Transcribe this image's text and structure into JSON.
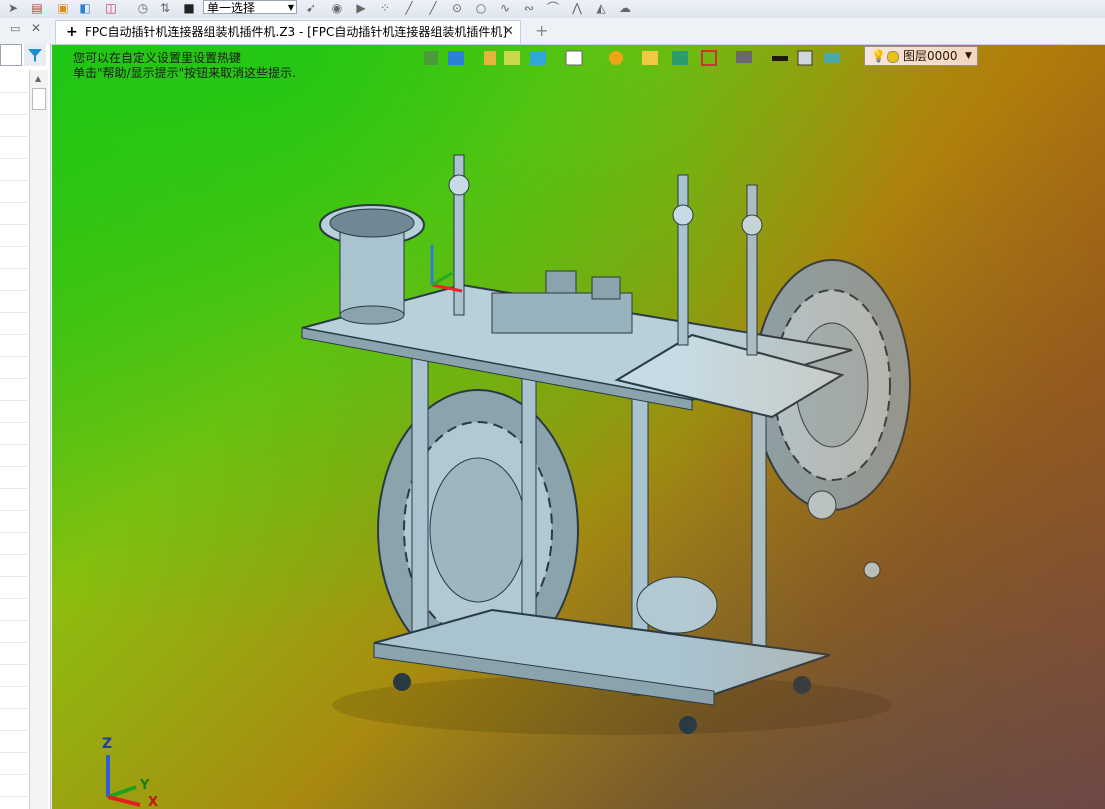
{
  "toolbar": {
    "filter_value": "单一选择",
    "icons": [
      "select-arrow-icon",
      "layers-icon",
      "save-icon",
      "export-icon",
      "print-icon",
      "history-icon",
      "sort-icon",
      "stop-icon",
      "pick-icon",
      "point-icon",
      "play-icon",
      "scatter-icon",
      "line-icon",
      "line2-icon",
      "point2-icon",
      "circle-icon",
      "curve-icon",
      "wave-icon",
      "arc-icon",
      "tangent-icon",
      "mesh-icon",
      "cloud-icon"
    ]
  },
  "tabs": {
    "add_symbol": "+",
    "doc_title": "FPC自动插针机连接器组装机插件机.Z3 - [FPC自动插针机连接器组装机插件机]",
    "close_symbol": "✕",
    "new_tab_symbol": "+"
  },
  "viewport": {
    "hint_line1": "您可以在自定义设置里设置热键",
    "hint_line2": "单击\"帮助/显示提示\"按钮来取消这些提示.",
    "layer_value": "图层0000",
    "axis_x": "X",
    "axis_y": "Y",
    "axis_z": "Z"
  },
  "colors": {
    "accent": "#2e7fd6",
    "machine_body": "#a9c3cf",
    "machine_dark": "#2a3a44"
  }
}
